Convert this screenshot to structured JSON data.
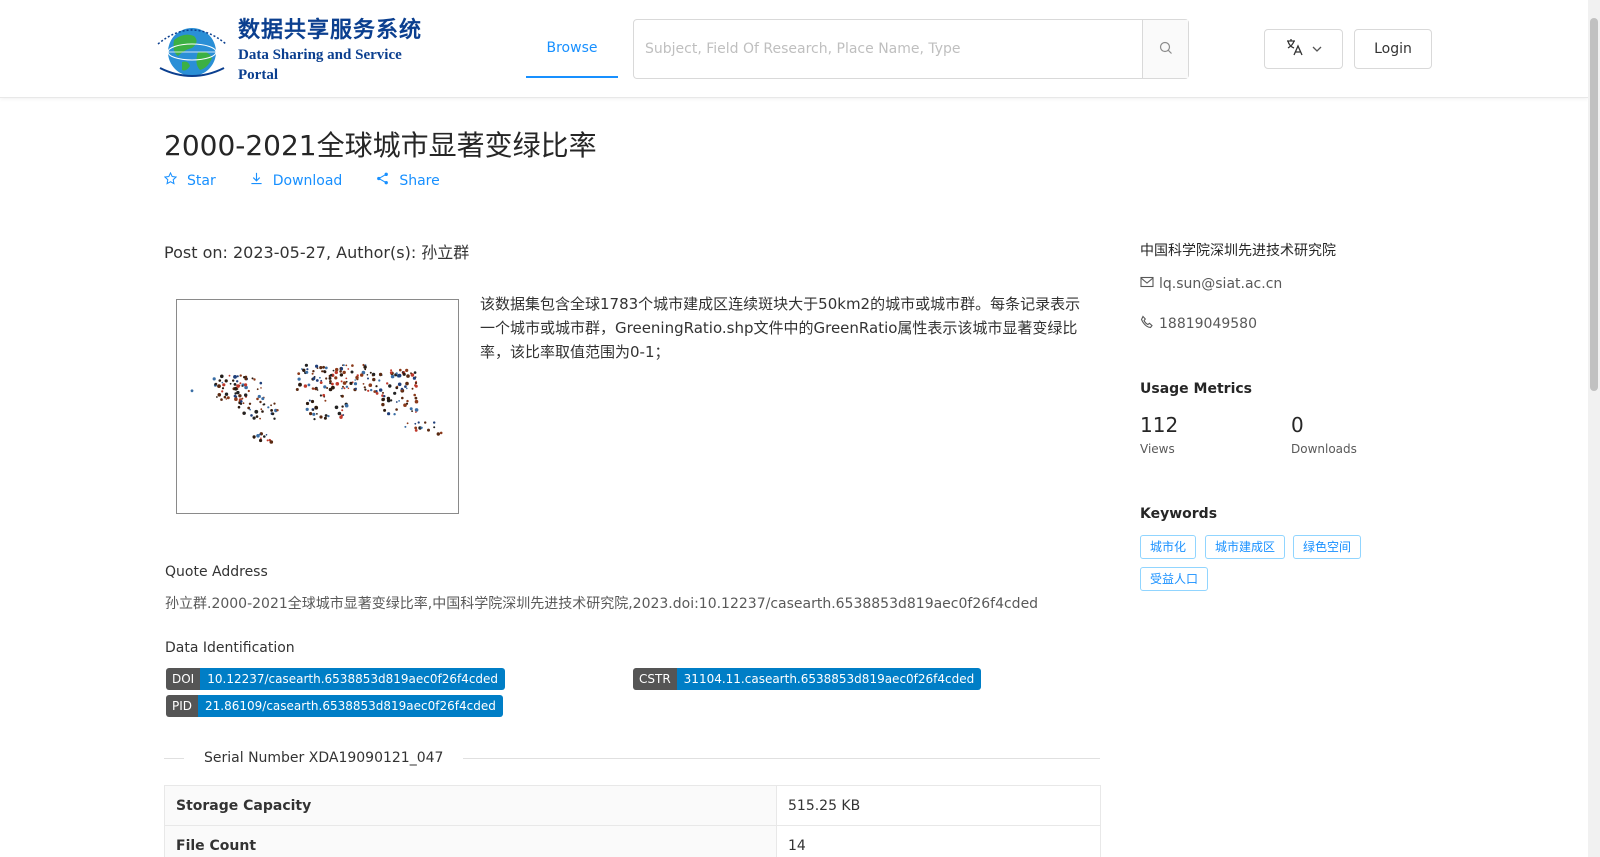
{
  "header": {
    "logo_cn": "数据共享服务系统",
    "logo_en": "Data Sharing and Service Portal",
    "nav_browse": "Browse",
    "search_placeholder": "Subject, Field Of Research, Place Name, Type",
    "login": "Login"
  },
  "dataset": {
    "title": "2000-2021全球城市显著变绿比率",
    "actions": {
      "star": "Star",
      "download": "Download",
      "share": "Share"
    },
    "post_on": "Post on: 2023-05-27, Author(s): 孙立群",
    "description": "该数据集包含全球1783个城市建成区连续斑块大于50km2的城市或城市群。每条记录表示一个城市或城市群，GreeningRatio.shp文件中的GreenRatio属性表示该城市显著变绿比率，该比率取值范围为0-1；",
    "quote_label": "Quote Address",
    "quote_text": "孙立群.2000-2021全球城市显著变绿比率,中国科学院深圳先进技术研究院,2023.doi:10.12237/casearth.6538853d819aec0f26f4cded",
    "identification_label": "Data Identification",
    "identifiers": {
      "doi_key": "DOI",
      "doi_value": "10.12237/casearth.6538853d819aec0f26f4cded",
      "cstr_key": "CSTR",
      "cstr_value": "31104.11.casearth.6538853d819aec0f26f4cded",
      "pid_key": "PID",
      "pid_value": "21.86109/casearth.6538853d819aec0f26f4cded"
    },
    "serial": "Serial Number XDA19090121_047",
    "table": [
      {
        "key": "Storage Capacity",
        "value": "515.25 KB"
      },
      {
        "key": "File Count",
        "value": "14"
      }
    ]
  },
  "sidebar": {
    "org": "中国科学院深圳先进技术研究院",
    "email": "lq.sun@siat.ac.cn",
    "phone": "18819049580",
    "usage_heading": "Usage Metrics",
    "views_value": "112",
    "views_label": "Views",
    "downloads_value": "0",
    "downloads_label": "Downloads",
    "keywords_heading": "Keywords",
    "keywords": [
      "城市化",
      "城市建成区",
      "绿色空间",
      "受益人口"
    ]
  },
  "colors": {
    "accent": "#1890ff",
    "badge_key": "#555555",
    "badge_value": "#007ec6",
    "logo": "#0b3f8f"
  }
}
